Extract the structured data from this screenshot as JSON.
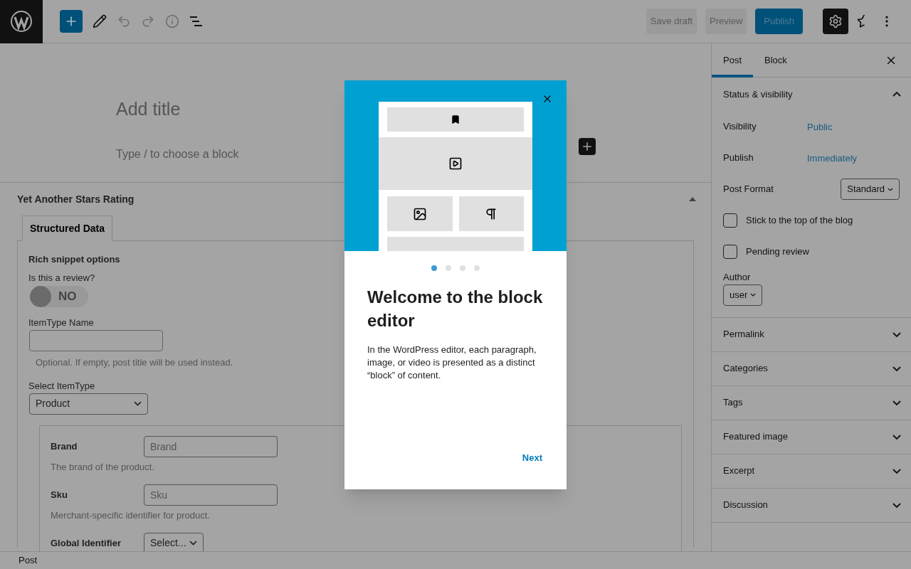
{
  "toolbar": {
    "settings_pressed": true,
    "buttons": [
      {
        "kind": "secondary",
        "label": "Save draft"
      },
      {
        "kind": "secondary",
        "label": "Preview"
      },
      {
        "kind": "primary",
        "label": "Publish"
      }
    ]
  },
  "editor": {
    "title_placeholder": "Add title",
    "block_placeholder": "Type / to choose a block"
  },
  "metabox": {
    "title": "Yet Another Stars Rating",
    "expanded": true,
    "tabs": [
      {
        "label": "Structured Data",
        "selected": true
      }
    ],
    "section_title": "Rich snippet options",
    "review_label": "Is this a review?",
    "review_toggle": {
      "on": false,
      "label": "NO"
    },
    "name_field": {
      "label": "ItemType Name",
      "help": "Optional. If empty, post title will be used instead."
    },
    "itemtype": {
      "label": "Select ItemType",
      "value": "Product"
    },
    "fields": [
      {
        "kind": "text",
        "label": "Brand",
        "placeholder": "Brand",
        "help": "The brand of the product."
      },
      {
        "kind": "text",
        "label": "Sku",
        "placeholder": "Sku",
        "help": "Merchant-specific identifier for product."
      },
      {
        "kind": "select",
        "label": "Global Identifier",
        "value": "Select..."
      }
    ]
  },
  "sidebar": {
    "tabs": [
      {
        "label": "Post",
        "selected": true
      },
      {
        "label": "Block",
        "selected": false
      }
    ],
    "sections": [
      {
        "title": "Status & visibility",
        "expanded": true,
        "rows": [
          {
            "kind": "link",
            "label": "Visibility",
            "value": "Public"
          },
          {
            "kind": "link",
            "label": "Publish",
            "value": "Immediately"
          },
          {
            "kind": "select",
            "label": "Post Format",
            "value": "Standard"
          },
          {
            "kind": "checkbox",
            "label": "Stick to the top of the blog",
            "checked": false
          },
          {
            "kind": "checkbox",
            "label": "Pending review",
            "checked": false
          }
        ],
        "author": {
          "label": "Author",
          "value": "user"
        }
      },
      {
        "title": "Permalink",
        "expanded": false
      },
      {
        "title": "Categories",
        "expanded": false
      },
      {
        "title": "Tags",
        "expanded": false
      },
      {
        "title": "Featured image",
        "expanded": false
      },
      {
        "title": "Excerpt",
        "expanded": false
      },
      {
        "title": "Discussion",
        "expanded": false
      }
    ]
  },
  "status_bar": {
    "label": "Post"
  },
  "modal": {
    "dots": [
      {
        "selected": true
      },
      {
        "selected": false
      },
      {
        "selected": false
      },
      {
        "selected": false
      }
    ],
    "title": "Welcome to the block editor",
    "body": "In the WordPress editor, each paragraph, image, or video is presented as a distinct “block” of content.",
    "next": "Next"
  }
}
